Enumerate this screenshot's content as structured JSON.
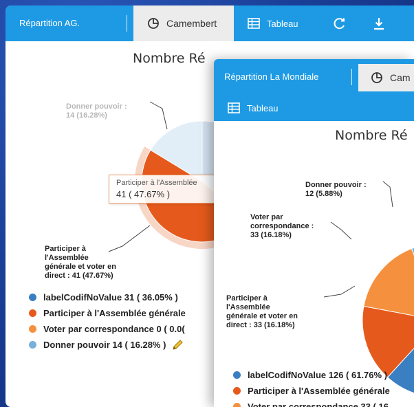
{
  "left": {
    "toolbar": {
      "title": "Répartition AG.",
      "tab_pie": "Camembert",
      "tab_table": "Tableau"
    },
    "chart_title": "Nombre Ré",
    "labels": {
      "donner_line1": "Donner pouvoir :",
      "donner_line2": "14 (16.28%)",
      "participer": [
        "Participer à",
        "l'Assemblée",
        "générale et voter en",
        "direct : 41 (47.67%)"
      ]
    },
    "tooltip": {
      "title": "Participer à l'Assemblée",
      "value": "41 ( 47.67% )"
    },
    "legend": [
      {
        "label": "labelCodifNoValue 31 ( 36.05% )",
        "color": "#3a7fc1"
      },
      {
        "label": "Participer à l'Assemblée générale",
        "color": "#e55a1c"
      },
      {
        "label": "Voter par correspondance 0 ( 0.0(",
        "color": "#f5913e"
      },
      {
        "label": "Donner pouvoir 14 ( 16.28% )",
        "color": "#79b0d9"
      }
    ]
  },
  "right": {
    "toolbar": {
      "title": "Répartition La Mondiale",
      "tab_pie": "Cam",
      "tab_table": "Tableau"
    },
    "chart_title": "Nombre Ré",
    "labels": {
      "donner": [
        "Donner pouvoir :",
        "12 (5.88%)"
      ],
      "voter": [
        "Voter par",
        "correspondance :",
        "33 (16.18%)"
      ],
      "participer": [
        "Participer à",
        "l'Assemblée",
        "générale et voter en",
        "direct : 33 (16.18%)"
      ]
    },
    "legend": [
      {
        "label": "labelCodifNoValue 126 ( 61.76% )",
        "color": "#3a7fc1"
      },
      {
        "label": "Participer à l'Assemblée générale",
        "color": "#e55a1c"
      },
      {
        "label": "Voter par correspondance 33 ( 16.",
        "color": "#f5913e"
      }
    ]
  },
  "chart_data": [
    {
      "type": "pie",
      "title": "Nombre Ré",
      "categories": [
        "labelCodifNoValue",
        "Participer à l'Assemblée générale et voter en direct",
        "Voter par correspondance",
        "Donner pouvoir"
      ],
      "values": [
        31,
        41,
        0,
        14
      ],
      "percentages": [
        36.05,
        47.67,
        0.0,
        16.28
      ],
      "colors": [
        "#3a7fc1",
        "#e55a1c",
        "#f5913e",
        "#79b0d9"
      ]
    },
    {
      "type": "pie",
      "title": "Nombre Ré",
      "categories": [
        "labelCodifNoValue",
        "Participer à l'Assemblée générale et voter en direct",
        "Voter par correspondance",
        "Donner pouvoir"
      ],
      "values": [
        126,
        33,
        33,
        12
      ],
      "percentages": [
        61.76,
        16.18,
        16.18,
        5.88
      ],
      "colors": [
        "#3a7fc1",
        "#e55a1c",
        "#f5913e",
        "#79b0d9"
      ]
    }
  ]
}
